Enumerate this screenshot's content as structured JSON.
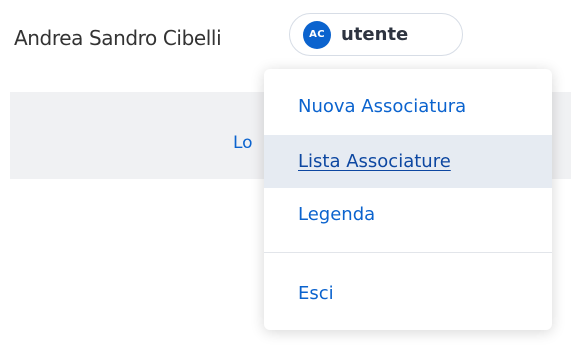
{
  "header": {
    "user_name": "Andrea Sandro Cibelli",
    "avatar_initials": "AC",
    "role": "utente"
  },
  "background": {
    "partial_text": "Lo"
  },
  "dropdown": {
    "items": [
      {
        "label": "Nuova Associatura"
      },
      {
        "label": "Lista Associature",
        "active": true
      },
      {
        "label": "Legenda"
      },
      {
        "label": "Esci"
      }
    ]
  },
  "colors": {
    "accent": "#0b63ce",
    "active_bg": "#e6ebf2",
    "band_bg": "#f0f1f3"
  }
}
